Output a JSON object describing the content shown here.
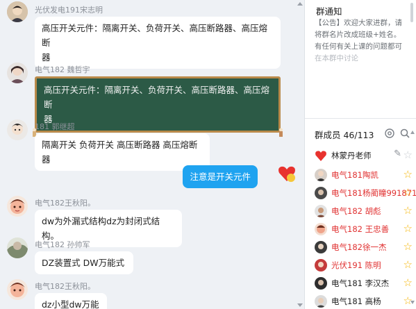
{
  "chat": {
    "messages": [
      {
        "sender": "光伏发电191宋志明",
        "text_line1": "高压开关元件：隔离开关、负荷开关、高压断路器、高压熔断",
        "text_line2": "器"
      },
      {
        "sender": "电气182 魏哲宇",
        "text_line1": "高压开关元件：隔离开关、负荷开关、高压断路器、高压熔断",
        "text_line2": "器"
      },
      {
        "sender": "181 郭继超",
        "text": "隔离开关 负荷开关 高压断路器 高压熔断器"
      },
      {
        "text": "注意是开关元件"
      },
      {
        "sender": "电气182王秋阳。",
        "text": "dw为外漏式结构dz为封闭式结构。"
      },
      {
        "sender": "电气182 孙帅军",
        "text": "DZ装置式  DW万能式"
      },
      {
        "sender": "电气182王秋阳。",
        "text": "dz小型dw万能"
      }
    ]
  },
  "side": {
    "notice_title": "群通知",
    "notice_lines": [
      "【公告】欢迎大家进群，请",
      "将群名片改成班级+姓名。",
      "有任何有关上课的问题都可",
      "在本群中讨论"
    ],
    "members_label": "群成员 46/113",
    "members": [
      {
        "name": "林蒙丹老师",
        "color": "#222222",
        "badge": "edit"
      },
      {
        "name": "电气181陶凯",
        "color": "#e03030",
        "badge": "star"
      },
      {
        "name": "电气181杨蔺瞳9918713",
        "color": "#e03030",
        "badge": "star"
      },
      {
        "name": "电气182 胡彪",
        "color": "#e03030",
        "badge": "star"
      },
      {
        "name": "电气182 王忠善",
        "color": "#e03030",
        "badge": "star"
      },
      {
        "name": "电气182徐一杰",
        "color": "#e03030",
        "badge": "star"
      },
      {
        "name": "光伏191 陈明",
        "color": "#e03030",
        "badge": "star"
      },
      {
        "name": "电气181  李汉杰",
        "color": "#222222",
        "badge": "star"
      },
      {
        "name": "电气181 高杨",
        "color": "#222222",
        "badge": "star"
      }
    ]
  },
  "colors": {
    "accent_blue": "#1fa3f0",
    "vip_red": "#e03030",
    "star": "#f5b400",
    "board_green": "#2c5a46"
  }
}
